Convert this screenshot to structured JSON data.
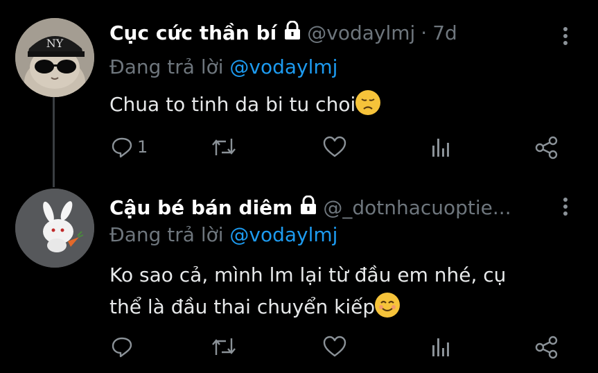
{
  "tweets": [
    {
      "name": "Cục cức thần bí",
      "handle": "@vodaylmj",
      "time": "7d",
      "replying_prefix": "Đang trả lời ",
      "replying_to": "@vodaylmj",
      "text": "Chua to tinh da bi tu choi",
      "emoji": "disappointed-face",
      "actions": {
        "reply_count": "1",
        "retweet_count": "",
        "like_count": ""
      },
      "avatar": "cat-in-ny-cap-avatar"
    },
    {
      "name": "Cậu bé bán diêm",
      "handle": "@_dotnhacuoptie...",
      "replying_prefix": "Đang trả lời ",
      "replying_to": "@vodaylmj",
      "text_line1": "Ko sao cả, mình lm lại từ đầu em nhé, cụ",
      "text_line2": "thể là đầu thai chuyển kiếp",
      "emoji": "smiling-face",
      "actions": {
        "reply_count": "",
        "retweet_count": "",
        "like_count": ""
      },
      "avatar": "white-rabbit-avatar"
    }
  ],
  "colors": {
    "background": "#000000",
    "text": "#e7e9ea",
    "muted": "#6e767d",
    "accent": "#1d9bf0"
  }
}
